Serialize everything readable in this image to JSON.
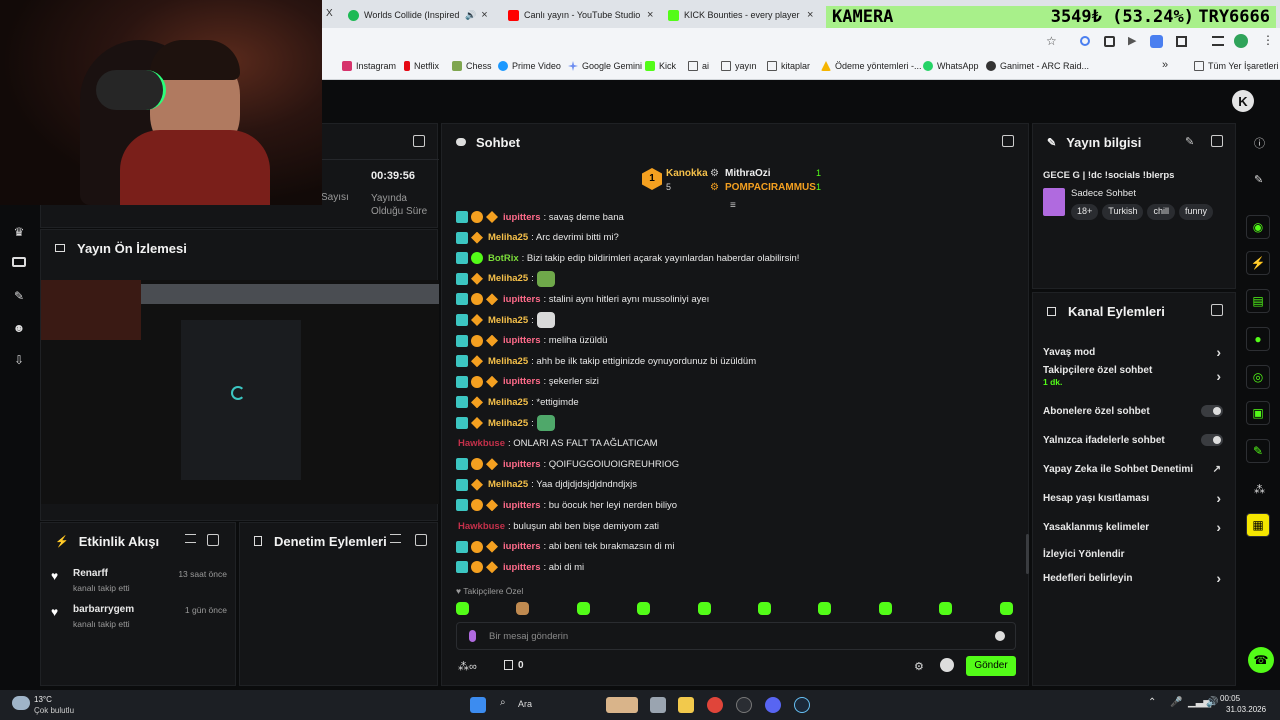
{
  "tabs": [
    {
      "label": "Worlds Collide (Inspired by",
      "close": "×"
    },
    {
      "label": "Canlı yayın - YouTube Studio",
      "close": "×"
    },
    {
      "label": "KICK Bounties - every player fo",
      "close": "×"
    }
  ],
  "tab_close_first": "X",
  "ticker": {
    "name": "KAMERA",
    "value": "3549₺ (53.24%)",
    "currency": "TRY6666"
  },
  "bookmarks": [
    "Instagram",
    "Netflix",
    "Chess",
    "Prime Video",
    "Google Gemini",
    "Kick",
    "ai",
    "yayın",
    "kitaplar",
    "Ödeme yöntemleri -...",
    "WhatsApp",
    "Ganimet - ARC Raid...",
    "Tüm Yer İşaretleri"
  ],
  "stats": {
    "viewers_label": "Sayısı",
    "time_value": "00:39:56",
    "time_label": "Yayında Olduğu Süre"
  },
  "preview": {
    "title": "Yayın Ön İzlemesi"
  },
  "activity": {
    "title": "Etkinlik Akışı",
    "items": [
      {
        "user": "Renarff",
        "action": "kanalı takip etti",
        "time": "13 saat önce"
      },
      {
        "user": "barbarrygem",
        "action": "kanalı takip etti",
        "time": "1 gün önce"
      }
    ]
  },
  "moderation": {
    "title": "Denetim Eylemleri"
  },
  "chat": {
    "title": "Sohbet",
    "leaders": [
      {
        "rank": "1",
        "name": "Kanokka",
        "count": "5"
      },
      {
        "name": "MithraOzi",
        "count": "1"
      },
      {
        "name": "POMPACIRAMMUS",
        "count": "1"
      }
    ],
    "messages": [
      {
        "user": "iupitters",
        "text": ": savaş deme bana",
        "color": "#ff6b8a",
        "badges": "3"
      },
      {
        "user": "Meliha25",
        "text": ": Arc devrimi bitti mi?",
        "color": "#f5c04a",
        "badges": "2"
      },
      {
        "user": "BotRix",
        "text": ": Bizi takip edip bildirimleri açarak yayınlardan haberdar olabilirsin!",
        "color": "#7bdc3a",
        "badges": "bot"
      },
      {
        "user": "Meliha25",
        "text": ": ",
        "color": "#f5c04a",
        "badges": "2",
        "emote": "#6fa84a"
      },
      {
        "user": "iupitters",
        "text": ": stalini aynı hitleri aynı mussoliniyi ayeı",
        "color": "#ff6b8a",
        "badges": "3"
      },
      {
        "user": "Meliha25",
        "text": ": ",
        "color": "#f5c04a",
        "badges": "2",
        "emote": "#d9d9d9"
      },
      {
        "user": "iupitters",
        "text": ": meliha üzüldü",
        "color": "#ff6b8a",
        "badges": "3"
      },
      {
        "user": "Meliha25",
        "text": ": ahh be ilk takip ettiginizde oynuyordunuz bi üzüldüm",
        "color": "#f5c04a",
        "badges": "2"
      },
      {
        "user": "iupitters",
        "text": ": şekerler sizi",
        "color": "#ff6b8a",
        "badges": "3"
      },
      {
        "user": "Meliha25",
        "text": ": *ettigimde",
        "color": "#f5c04a",
        "badges": "2"
      },
      {
        "user": "Meliha25",
        "text": ": ",
        "color": "#f5c04a",
        "badges": "2",
        "emote": "#4fa86a"
      },
      {
        "user": "Hawkbuse",
        "text": ": ONLARI AS FALT TA AĞLATICAM",
        "color": "#c4304a",
        "badges": "0"
      },
      {
        "user": "iupitters",
        "text": ": QOIFUGGOIUOIGREUHRIOG",
        "color": "#ff6b8a",
        "badges": "3"
      },
      {
        "user": "Meliha25",
        "text": ": Yaa djdjdjdsjdjdndndjxjs",
        "color": "#f5c04a",
        "badges": "2"
      },
      {
        "user": "iupitters",
        "text": ": bu öocuk her leyi nerden biliyo",
        "color": "#ff6b8a",
        "badges": "3"
      },
      {
        "user": "Hawkbuse",
        "text": ": buluşun abi ben bişe demiyom zati",
        "color": "#c4304a",
        "badges": "0"
      },
      {
        "user": "iupitters",
        "text": ": abi beni tek bırakmazsın di mi",
        "color": "#ff6b8a",
        "badges": "3"
      },
      {
        "user": "iupitters",
        "text": ": abi di mi",
        "color": "#ff6b8a",
        "badges": "3"
      }
    ],
    "followers_only": "Takipçilere Özel",
    "input_placeholder": "Bir mesaj gönderin",
    "points": "0",
    "send": "Gönder"
  },
  "stream_info": {
    "title": "Yayın bilgisi",
    "stream_title": "GECE G | !dc !socials !blerps",
    "category": "Sadece Sohbet",
    "tags": [
      "18+",
      "Turkish",
      "chill",
      "funny"
    ]
  },
  "channel_actions": {
    "title": "Kanal Eylemleri",
    "items": [
      {
        "label": "Yavaş mod",
        "kind": "chev"
      },
      {
        "label": "Takipçilere özel sohbet",
        "sub": "1 dk.",
        "kind": "chev"
      },
      {
        "label": "Abonelere özel sohbet",
        "kind": "toggle"
      },
      {
        "label": "Yalnızca ifadelerle sohbet",
        "kind": "toggle"
      },
      {
        "label": "Yapay Zeka ile Sohbet Denetimi",
        "kind": "ext"
      },
      {
        "label": "Hesap yaşı kısıtlaması",
        "kind": "chev"
      },
      {
        "label": "Yasaklanmış kelimeler",
        "kind": "chev"
      },
      {
        "label": "İzleyici Yönlendir",
        "kind": "none"
      },
      {
        "label": "Hedefleri belirleyin",
        "kind": "chev"
      }
    ]
  },
  "taskbar": {
    "weather_temp": "13°C",
    "weather_desc": "Çok bulutlu",
    "search": "Ara",
    "time": "00:05",
    "date": "31.03.2026"
  },
  "colors": {
    "accent": "#53fc18",
    "panel": "#141517",
    "bg": "#0b0c0d"
  }
}
